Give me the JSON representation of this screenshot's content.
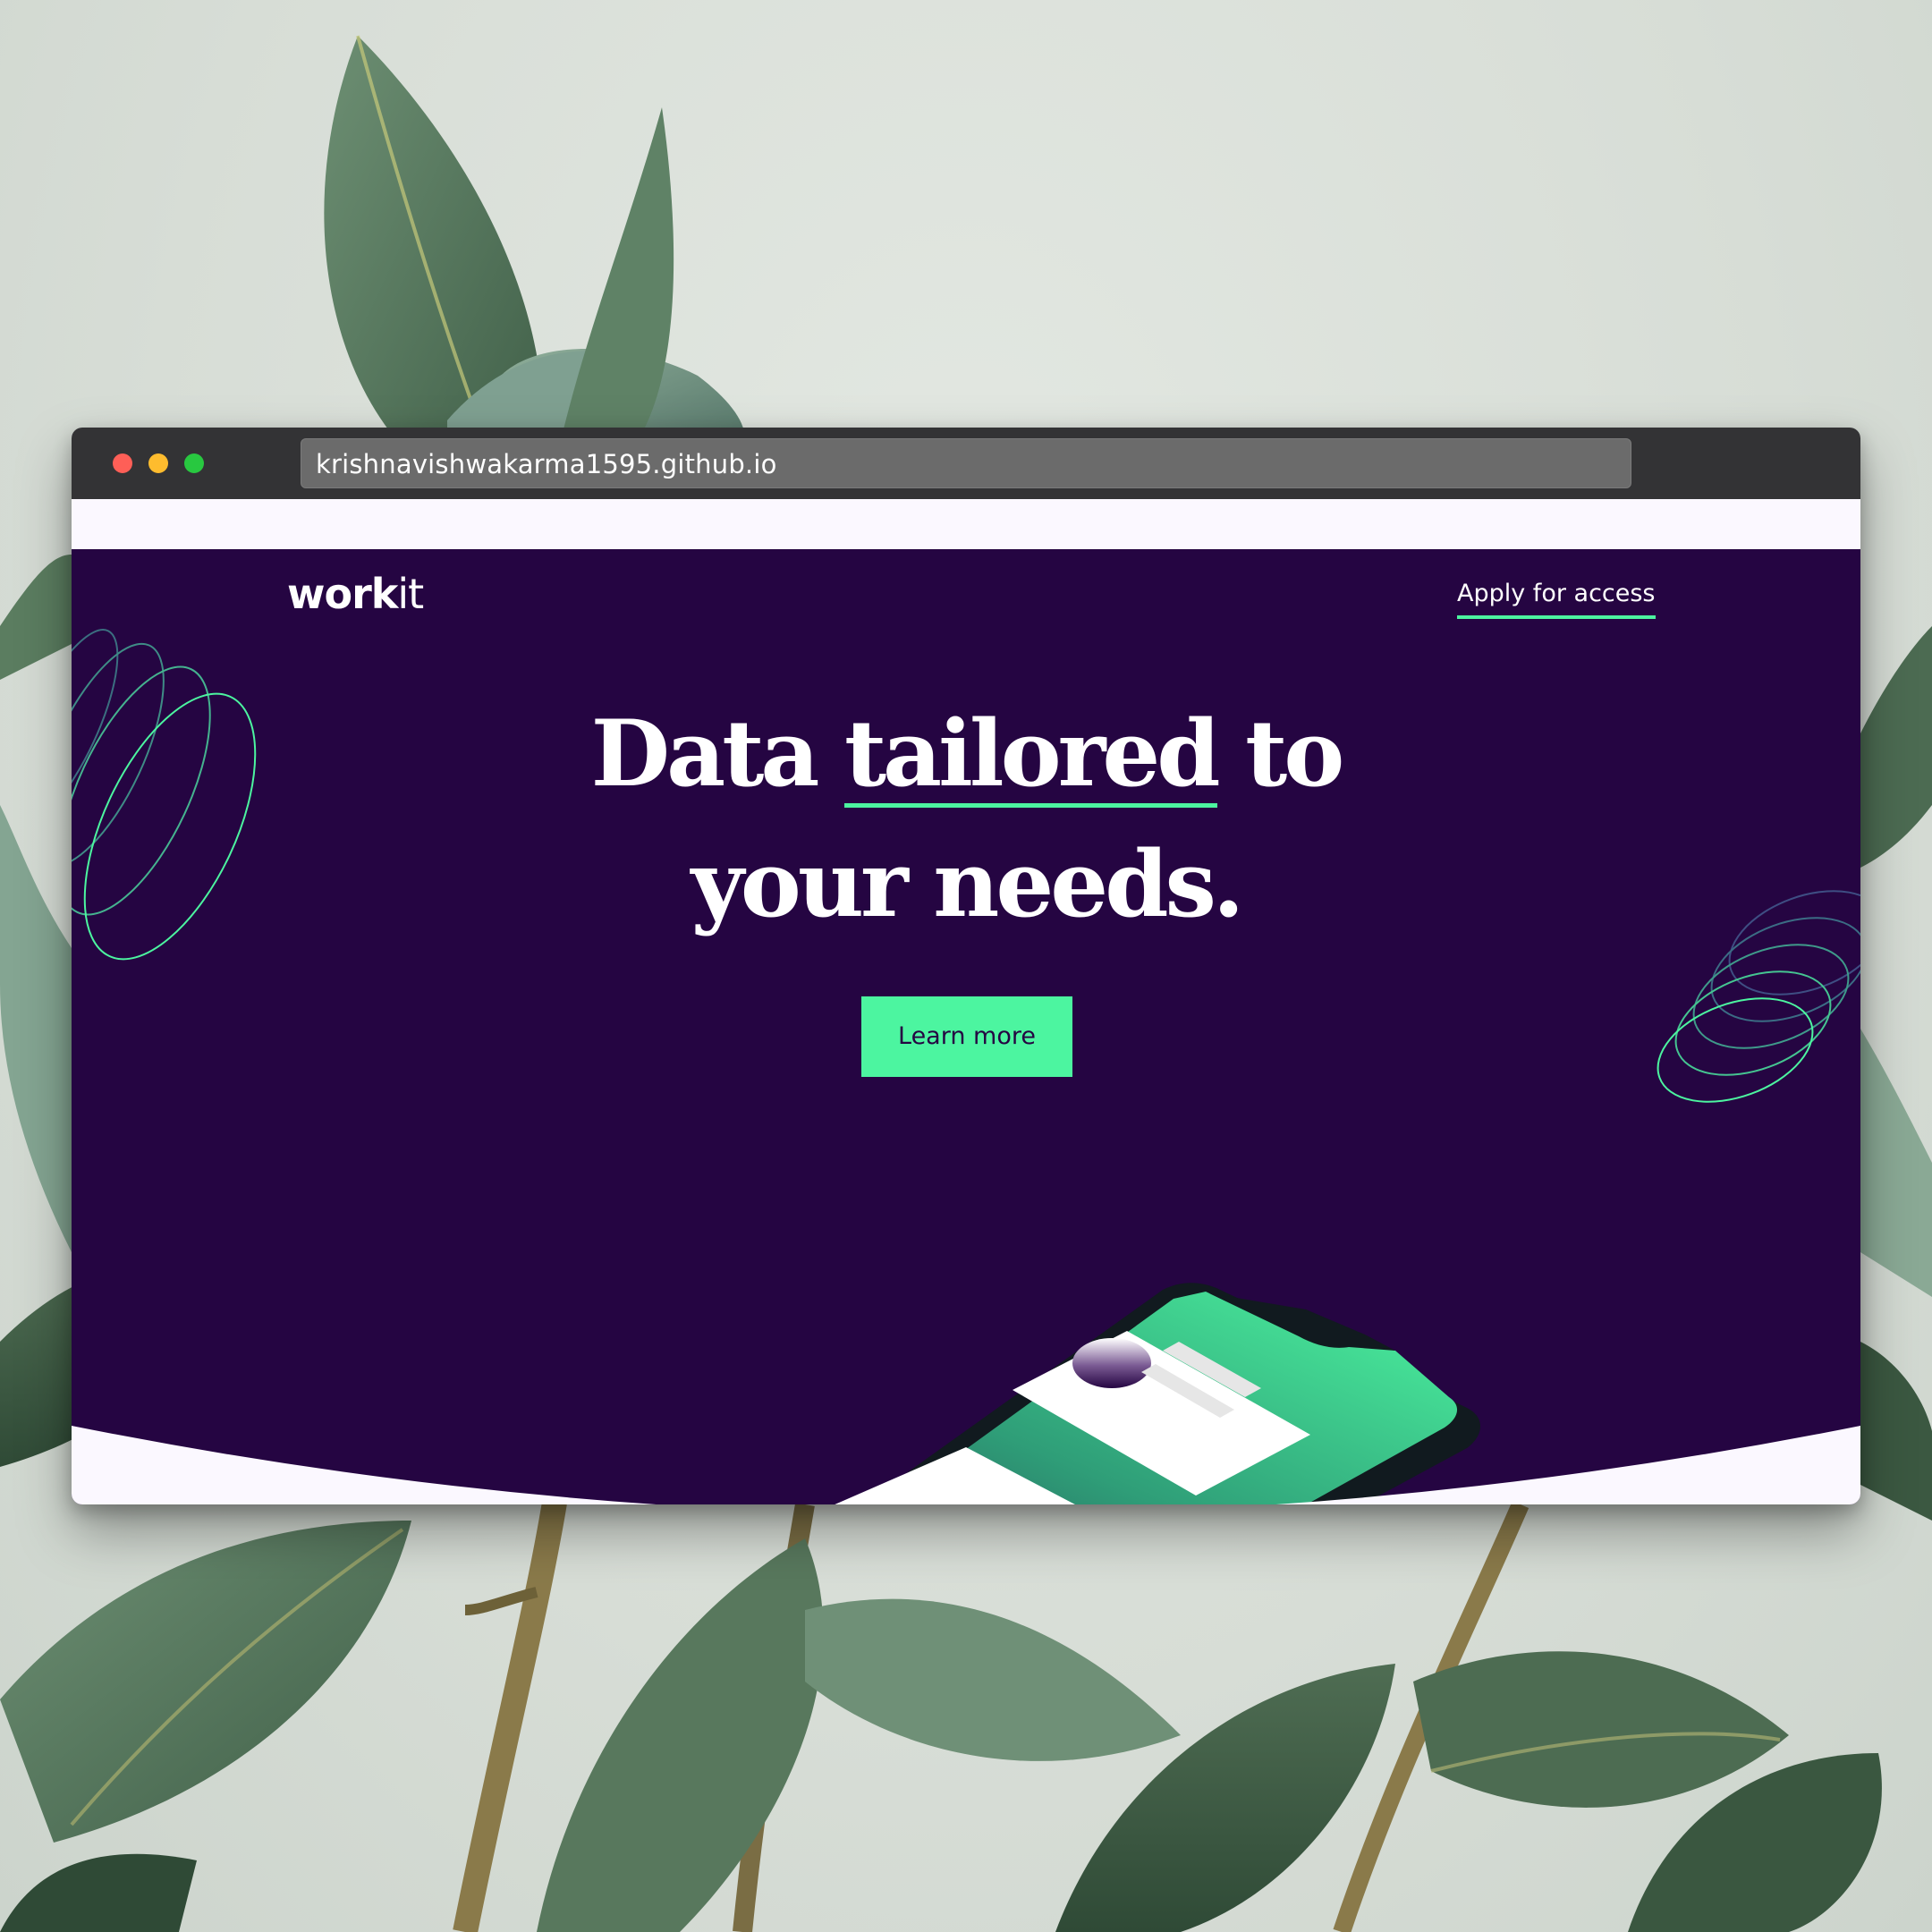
{
  "browser": {
    "url": "krishnavishwakarma1595.github.io"
  },
  "site": {
    "logo_bold": "work",
    "logo_light": "it",
    "nav_link": "Apply for access"
  },
  "hero": {
    "headline_part1": "Data ",
    "headline_highlight": "tailored",
    "headline_part2": " to",
    "headline_line2": "your needs.",
    "cta_label": "Learn more"
  },
  "colors": {
    "hero_background": "#250542",
    "accent": "#4cf5a0",
    "page_background": "#fbf8ff",
    "titlebar": "#333335"
  }
}
